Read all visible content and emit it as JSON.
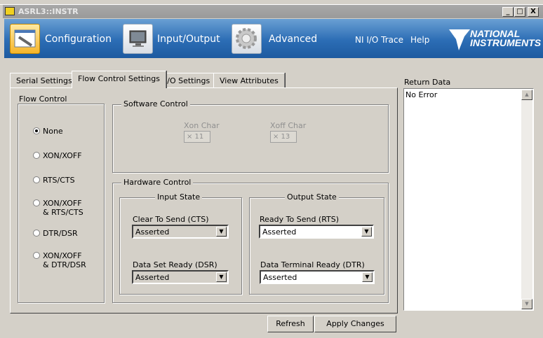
{
  "window": {
    "title": "ASRL3::INSTR",
    "minimize": "_",
    "maximize": "□",
    "close": "X"
  },
  "header": {
    "nav": [
      {
        "label": "Configuration",
        "icon": "wrench-settings-icon",
        "active": true
      },
      {
        "label": "Input/Output",
        "icon": "monitor-icon"
      },
      {
        "label": "Advanced",
        "icon": "gear-icon"
      }
    ],
    "trace": "NI I/O Trace",
    "help": "Help",
    "logo_line1": "NATIONAL",
    "logo_line2": "INSTRUMENTS",
    "accent": "#2c6db5"
  },
  "tabs": [
    "Serial Settings",
    "Flow Control Settings",
    "I/O Settings",
    "View Attributes"
  ],
  "active_tab": "Flow Control Settings",
  "flow_control": {
    "title": "Flow Control",
    "options": [
      {
        "l1": "None",
        "l2": ""
      },
      {
        "l1": "XON/XOFF",
        "l2": ""
      },
      {
        "l1": "RTS/CTS",
        "l2": ""
      },
      {
        "l1": "XON/XOFF",
        "l2": "& RTS/CTS"
      },
      {
        "l1": "DTR/DSR",
        "l2": ""
      },
      {
        "l1": "XON/XOFF",
        "l2": "& DTR/DSR"
      }
    ],
    "selected": "None"
  },
  "software": {
    "title": "Software Control",
    "xon_label": "Xon Char",
    "xon_value": "× 11",
    "xoff_label": "Xoff Char",
    "xoff_value": "× 13"
  },
  "hardware": {
    "title": "Hardware Control",
    "input_title": "Input State",
    "output_title": "Output State",
    "cts_label": "Clear To Send (CTS)",
    "cts_value": "Asserted",
    "dsr_label": "Data Set Ready (DSR)",
    "dsr_value": "Asserted",
    "rts_label": "Ready To Send (RTS)",
    "rts_value": "Asserted",
    "dtr_label": "Data Terminal Ready (DTR)",
    "dtr_value": "Asserted"
  },
  "return_data": {
    "label": "Return Data",
    "value": "No Error"
  },
  "buttons": {
    "refresh": "Refresh",
    "apply": "Apply Changes"
  }
}
